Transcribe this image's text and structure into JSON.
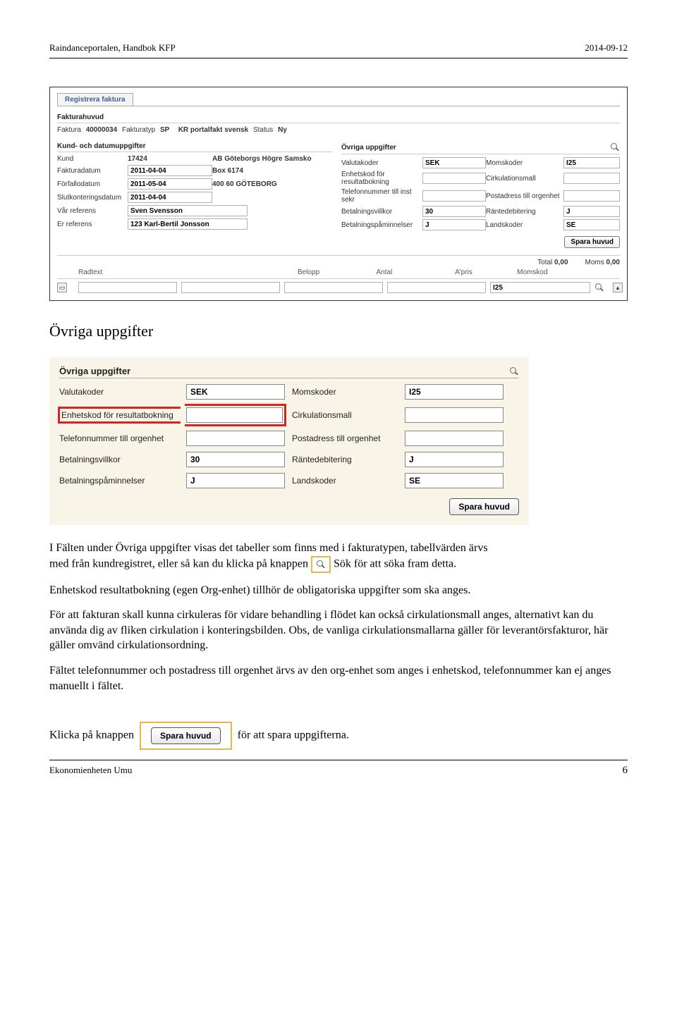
{
  "header": {
    "left": "Raindanceportalen, Handbok KFP",
    "right": "2014-09-12"
  },
  "screenshot1": {
    "tab": "Registrera faktura",
    "fakturahuvud_title": "Fakturahuvud",
    "faktura_label": "Faktura",
    "faktura_nr": "40000034",
    "fakturatyp_label": "Fakturatyp",
    "fakturatyp": "SP",
    "fakturatyp_text": "KR portalfakt svensk",
    "status_label": "Status",
    "status": "Ny",
    "kund_section": "Kund- och datumuppgifter",
    "kund_label": "Kund",
    "kund_nr": "17424",
    "kund_namn": "AB Göteborgs Högre Samsko",
    "kund_adr1": "Box 6174",
    "kund_adr2": "400 60 GÖTEBORG",
    "fakturadatum_label": "Fakturadatum",
    "fakturadatum": "2011-04-04",
    "forfallodatum_label": "Förfallodatum",
    "forfallodatum": "2011-05-04",
    "slutkont_label": "Slutkonteringsdatum",
    "slutkont": "2011-04-04",
    "varref_label": "Vår referens",
    "varref": "Sven Svensson",
    "erref_label": "Er referens",
    "erref": "123 Karl-Bertil Jonsson",
    "ovriga_title": "Övriga uppgifter",
    "valutakoder_label": "Valutakoder",
    "valutakoder": "SEK",
    "momskoder_label": "Momskoder",
    "momskoder": "I25",
    "enhetskod_label": "Enhetskod för resultatbokning",
    "enhetskod": "",
    "cirkmall_label": "Cirkulationsmall",
    "cirkmall": "",
    "tel_inst_label": "Telefonnummer till inst sekr",
    "tel_inst": "",
    "postadr_label": "Postadress till orgenhet",
    "postadr": "",
    "betvillkor_label": "Betalningsvillkor",
    "betvillkor": "30",
    "rantedeb_label": "Räntedebitering",
    "rantedeb": "J",
    "betpamin_label": "Betalningspåminnelser",
    "betpamin": "J",
    "landskoder_label": "Landskoder",
    "landskoder": "SE",
    "spara_huvud_btn": "Spara huvud",
    "total_label": "Total",
    "total_val": "0,00",
    "moms_label": "Moms",
    "moms_val": "0,00",
    "tbl": {
      "radtext": "Radtext",
      "belopp": "Belopp",
      "antal": "Antal",
      "apris": "A'pris",
      "momskod": "Momskod",
      "row_momskod": "I25"
    }
  },
  "section_heading": "Övriga uppgifter",
  "panel2": {
    "title": "Övriga uppgifter",
    "valutakoder_label": "Valutakoder",
    "valutakoder": "SEK",
    "momskoder_label": "Momskoder",
    "momskoder": "I25",
    "enhetskod_label": "Enhetskod för resultatbokning",
    "enhetskod": "",
    "cirkmall_label": "Cirkulationsmall",
    "cirkmall": "",
    "tel_label": "Telefonnummer till orgenhet",
    "tel": "",
    "postadr_label": "Postadress till orgenhet",
    "postadr": "",
    "betvillkor_label": "Betalningsvillkor",
    "betvillkor": "30",
    "rantedeb_label": "Räntedebitering",
    "rantedeb": "J",
    "betpamin_label": "Betalningspåminnelser",
    "betpamin": "J",
    "landskoder_label": "Landskoder",
    "landskoder": "SE",
    "spara_btn": "Spara huvud"
  },
  "body": {
    "p1a": "I Fälten under Övriga uppgifter visas det tabeller som finns med i fakturatypen, tabellvärden ärvs",
    "p1b": "med från kundregistret, eller så kan du klicka på knappen",
    "p1c": "Sök för att söka fram detta.",
    "p2": "Enhetskod resultatbokning (egen Org-enhet) tillhör de obligatoriska uppgifter som ska anges.",
    "p3": "För att fakturan skall kunna cirkuleras för vidare behandling i flödet kan också cirkulationsmall anges, alternativt kan du använda dig av fliken cirkulation i konteringsbilden. Obs, de vanliga cirkulationsmallarna gäller för leverantörsfakturor, här gäller omvänd cirkulationsordning.",
    "p4": "Fältet telefonnummer och postadress till orgenhet ärvs av den org-enhet som anges i enhetskod, telefonnummer kan ej anges manuellt i fältet.",
    "p5a": "Klicka på knappen",
    "p5b": "för att spara uppgifterna.",
    "spara_btn_inline": "Spara huvud"
  },
  "footer": {
    "left": "Ekonomienheten Umu",
    "page": "6"
  }
}
